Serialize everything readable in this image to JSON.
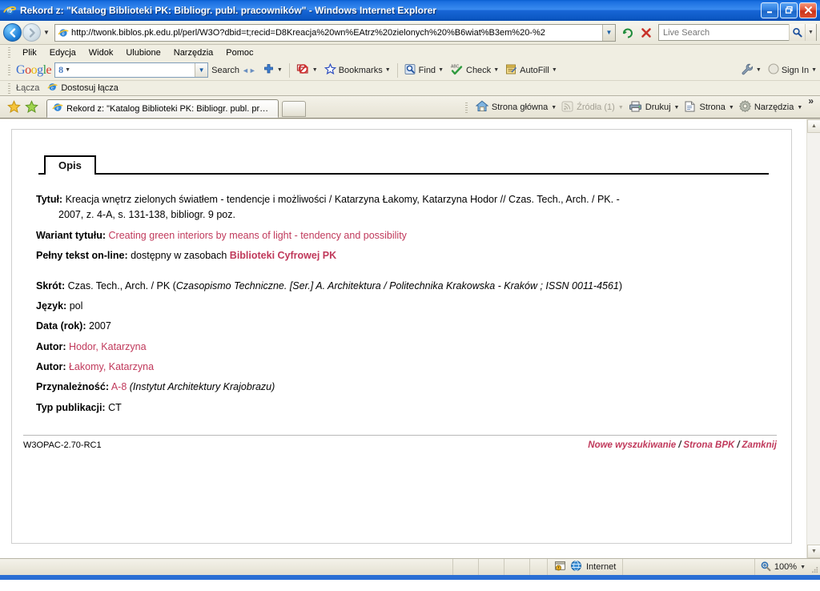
{
  "window": {
    "title": "Rekord z: \"Katalog Biblioteki PK: Bibliogr. publ. pracowników\" - Windows Internet Explorer",
    "minimize_label": "Minimalizuj",
    "maximize_label": "Przywróć",
    "close_label": "Zamknij"
  },
  "nav": {
    "back_label": "Wstecz",
    "forward_label": "Dalej",
    "history_label": "Ostatnie strony",
    "address_value": "http://twonk.biblos.pk.edu.pl/perl/W3O?dbid=t;recid=D8Kreacja%20wn%EAtrz%20zielonych%20%B6wiat%B3em%20-%2",
    "address_icon": "ie-page-icon",
    "refresh_icon": "refresh-icon",
    "stop_icon": "stop-icon",
    "search_placeholder": "Live Search",
    "search_value": "",
    "search_go_icon": "magnifier-icon",
    "search_options_icon": "chevron-down-icon"
  },
  "menu": {
    "items": [
      {
        "label": "Plik",
        "accel": "P"
      },
      {
        "label": "Edycja",
        "accel": "E"
      },
      {
        "label": "Widok",
        "accel": "W"
      },
      {
        "label": "Ulubione",
        "accel": "U"
      },
      {
        "label": "Narzędzia",
        "accel": "N"
      },
      {
        "label": "Pomoc",
        "accel": "c"
      }
    ]
  },
  "google_toolbar": {
    "logo": "Google",
    "mode_badge": "8",
    "query_value": "",
    "search_label": "Search",
    "plus_icon": "google-plus-icon",
    "blocked_icon": "popup-blocker-icon",
    "bookmarks_icon": "star-icon",
    "bookmarks_label": "Bookmarks",
    "find_icon": "find-magnifier-icon",
    "find_label": "Find",
    "check_icon": "spellcheck-icon",
    "check_label": "Check",
    "autofill_icon": "autofill-icon",
    "autofill_label": "AutoFill",
    "wrench_icon": "wrench-icon",
    "signin_icon": "signin-avatar-icon",
    "signin_label": "Sign In"
  },
  "links_bar": {
    "label": "Łącza",
    "customize_icon": "ie-page-icon",
    "customize_label": "Dostosuj łącza"
  },
  "tabs": {
    "favorites_icon": "favorites-star-icon",
    "add_favorite_icon": "add-favorite-icon",
    "items": [
      {
        "icon": "ie-page-icon",
        "label": "Rekord z: \"Katalog Biblioteki PK: Bibliogr. publ. pracow…",
        "active": true
      }
    ],
    "new_tab_label": ""
  },
  "command_bar": {
    "items": [
      {
        "icon": "home-icon",
        "label": "Strona główna",
        "has_menu": true,
        "disabled": false
      },
      {
        "icon": "feeds-icon",
        "label": "Źródła (1)",
        "has_menu": true,
        "disabled": true
      },
      {
        "icon": "print-icon",
        "label": "Drukuj",
        "has_menu": true,
        "disabled": false
      },
      {
        "icon": "page-icon",
        "label": "Strona",
        "has_menu": true,
        "disabled": false
      },
      {
        "icon": "tools-gear-icon",
        "label": "Narzędzia",
        "has_menu": true,
        "disabled": false
      }
    ],
    "overflow_label": "»"
  },
  "record": {
    "tab_label": "Opis",
    "fields": [
      {
        "label": "Tytuł:",
        "line1": "Kreacja wnętrz zielonych światłem - tendencje i możliwości / Katarzyna Łakomy, Katarzyna Hodor // Czas. Tech., Arch. / PK. -",
        "line2": "2007, z. 4-A, s. 131-138, bibliogr. 9 poz.",
        "style": "plain"
      },
      {
        "label": "Wariant tytułu:",
        "value": "Creating green interiors by means of light - tendency and possibility",
        "style": "red"
      },
      {
        "label": "Pełny tekst on-line:",
        "value": "dostępny w zasobach ",
        "link": "Biblioteki Cyfrowej PK",
        "style": "plain-link"
      },
      {
        "label": "Skrót:",
        "value": "Czas. Tech., Arch. / PK (",
        "italic": "Czasopismo Techniczne. [Ser.] A. Architektura / Politechnika Krakowska - Kraków ; ISSN 0011-4561",
        "value_end": ")",
        "style": "plain-italic"
      },
      {
        "label": "Język:",
        "value": "pol",
        "style": "plain"
      },
      {
        "label": "Data (rok):",
        "value": "2007",
        "style": "plain"
      },
      {
        "label": "Autor:",
        "value": "Hodor, Katarzyna",
        "style": "red"
      },
      {
        "label": "Autor:",
        "value": "Łakomy, Katarzyna",
        "style": "red"
      },
      {
        "label": "Przynależność:",
        "value": "A-8 ",
        "italic": "(Instytut Architektury Krajobrazu)",
        "style": "red-italic"
      },
      {
        "label": "Typ publikacji:",
        "value": "CT",
        "style": "plain"
      }
    ],
    "footer_version": "W3OPAC-2.70-RC1",
    "footer_links": [
      {
        "label": "Nowe wyszukiwanie"
      },
      {
        "label": "Strona BPK"
      },
      {
        "label": "Zamknij"
      }
    ],
    "footer_separator": "/"
  },
  "status_bar": {
    "message": "",
    "security_icon": "protected-mode-icon",
    "zone_icon": "globe-icon",
    "zone_label": "Internet",
    "zoom_icon": "zoom-magnifier-icon",
    "zoom_label": "100%",
    "zoom_menu_icon": "chevron-down-icon"
  },
  "colors": {
    "accent_red": "#c0395b",
    "title_blue": "#1a6fe0",
    "chrome_beige": "#f0eee2"
  }
}
